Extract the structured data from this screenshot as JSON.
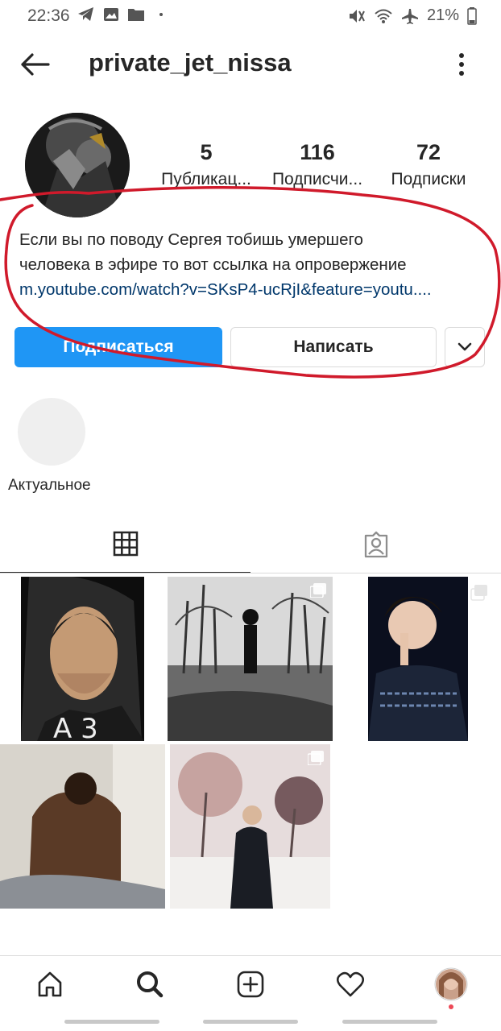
{
  "status_bar": {
    "time": "22:36",
    "battery": "21%",
    "left_icons": [
      "telegram-icon",
      "image-icon",
      "folder-icon",
      "dot-icon"
    ],
    "right_icons": [
      "mute-icon",
      "wifi-icon",
      "airplane-icon",
      "battery-icon"
    ]
  },
  "header": {
    "username": "private_jet_nissa"
  },
  "stats": [
    {
      "count": "5",
      "label": "Публикац..."
    },
    {
      "count": "116",
      "label": "Подписчи..."
    },
    {
      "count": "72",
      "label": "Подписки"
    }
  ],
  "bio": {
    "line1": "Если вы по поводу Сергея тобишь умершего",
    "line2": "человека в эфире то вот ссылка на опровержение",
    "link": "m.youtube.com/watch?v=SKsP4-ucRjI&feature=youtu...."
  },
  "buttons": {
    "follow": "Подписаться",
    "message": "Написать"
  },
  "highlight": {
    "label": "Актуальное"
  },
  "tabs": [
    "grid-icon",
    "tagged-icon"
  ],
  "colors": {
    "accent": "#1f96f5",
    "link": "#00376b",
    "annotation": "#d01a2b",
    "text": "#262626"
  },
  "nav": [
    "home-icon",
    "search-icon",
    "add-icon",
    "heart-icon",
    "profile-avatar"
  ]
}
